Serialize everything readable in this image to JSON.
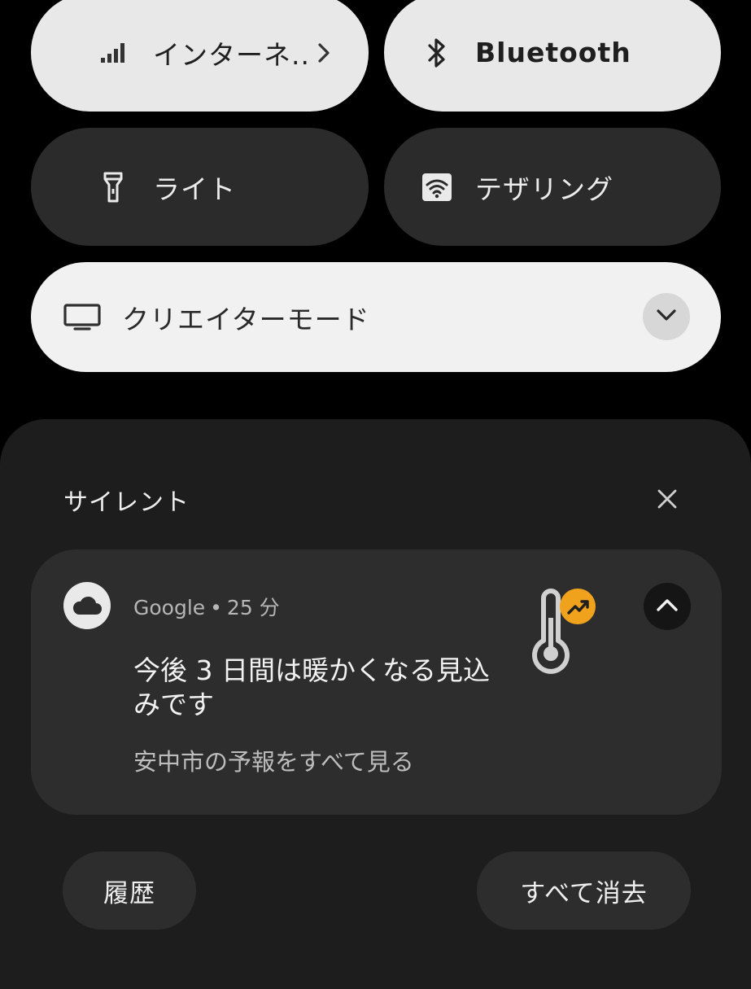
{
  "quick_settings": {
    "internet": {
      "label": "インターネ..",
      "icon": "signal-icon",
      "state": "on"
    },
    "bluetooth": {
      "label": "Bluetooth",
      "icon": "bluetooth-icon",
      "state": "on"
    },
    "flashlight": {
      "label": "ライト",
      "icon": "flashlight-icon",
      "state": "off"
    },
    "tethering": {
      "label": "テザリング",
      "icon": "hotspot-icon",
      "state": "off"
    },
    "creator_mode": {
      "label": "クリエイターモード",
      "icon": "tv-icon",
      "expand_icon": "chevron-down-icon"
    }
  },
  "notifications": {
    "section_title": "サイレント",
    "close_icon": "close-icon",
    "items": [
      {
        "app": "Google",
        "separator": "•",
        "time": "25 分",
        "app_icon": "cloud-icon",
        "title": "今後 3 日間は暖かくなる見込みです",
        "subtitle": "安中市の予報をすべて見る",
        "large_icon": "thermometer-up-icon",
        "expand_icon": "chevron-up-icon"
      }
    ],
    "history_label": "履歴",
    "clear_all_label": "すべて消去"
  },
  "colors": {
    "background": "#000000",
    "tile_on": "#e8e8e8",
    "tile_off": "#2b2b2b",
    "shade": "#1d1d1d",
    "card": "#2d2d2d",
    "accent_badge": "#f0a21c"
  }
}
